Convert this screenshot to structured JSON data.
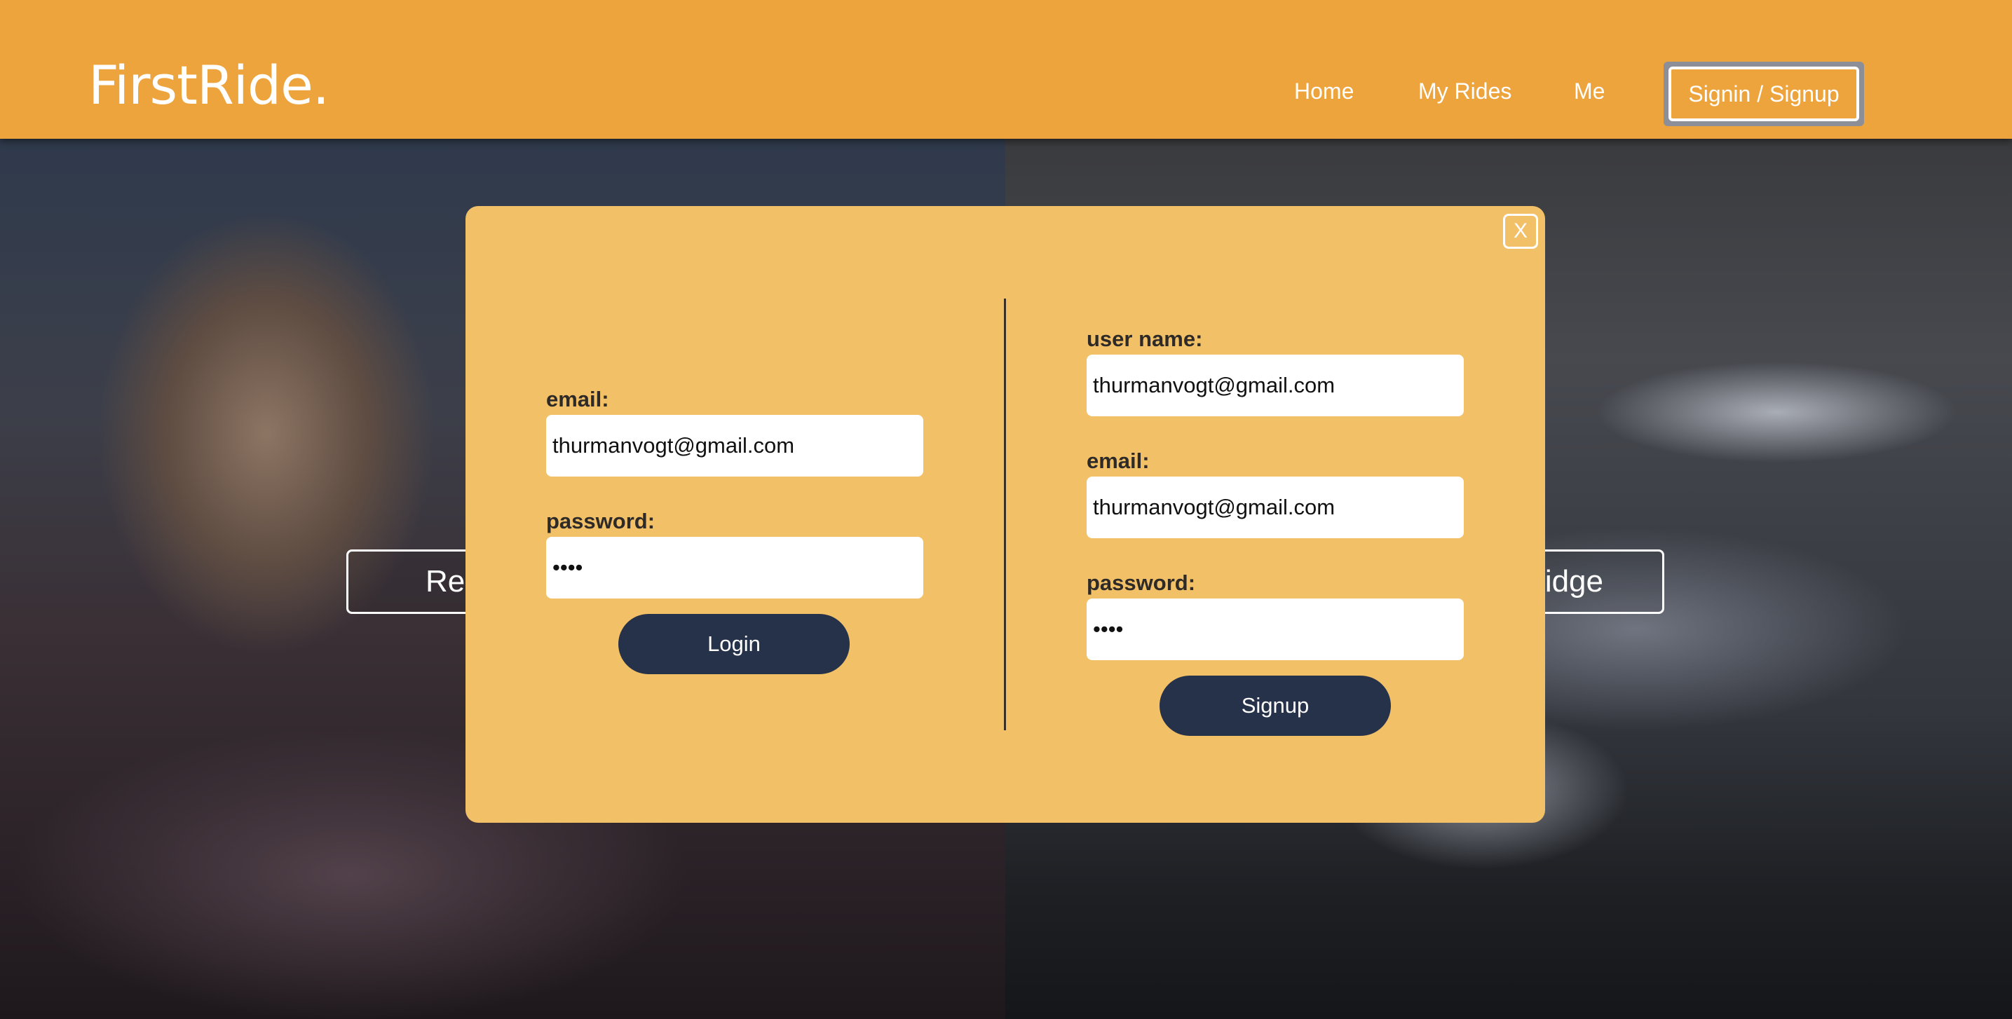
{
  "navbar": {
    "brand": "FirstRide.",
    "links": [
      "Home",
      "My Rides",
      "Me"
    ],
    "signin_label": "Signin / Signup",
    "color": "#eea43c"
  },
  "hero": {
    "left_button_partial": "Re",
    "right_button_partial": "idge"
  },
  "modal": {
    "close_label": "X",
    "background": "#f2c066",
    "login": {
      "email_label": "email:",
      "email_value": "thurmanvogt@gmail.com",
      "password_label": "password:",
      "password_value": "••••",
      "button_label": "Login"
    },
    "signup": {
      "username_label": "user name:",
      "username_value": "thurmanvogt@gmail.com",
      "email_label": "email:",
      "email_value": "thurmanvogt@gmail.com",
      "password_label": "password:",
      "password_value": "••••",
      "button_label": "Signup"
    },
    "button_color": "#26324a"
  }
}
